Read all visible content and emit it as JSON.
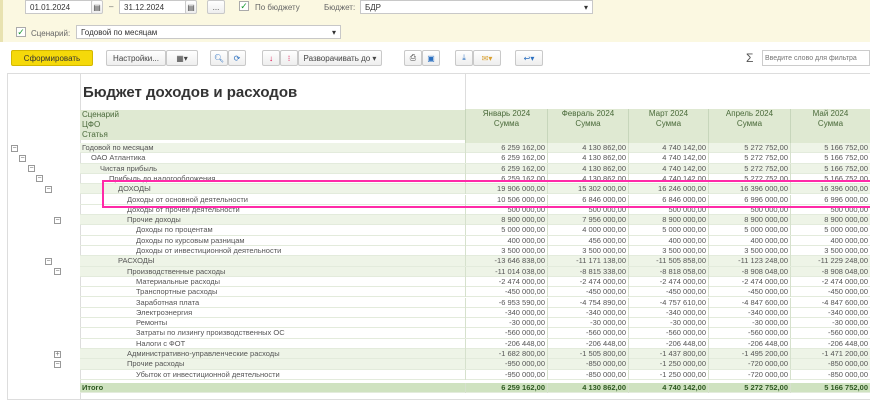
{
  "filters": {
    "date_from": "01.01.2024",
    "date_sep": "–",
    "date_to": "31.12.2024",
    "period_button": "...",
    "by_budget_label": "По бюджету",
    "by_budget_checked": true,
    "budget_label": "Бюджет:",
    "budget_value": "БДР",
    "scenario_label": "Сценарий:",
    "scenario_checked": true,
    "scenario_value": "Годовой по месяцам"
  },
  "toolbar": {
    "generate": "Сформировать",
    "settings": "Настройки...",
    "expand_to": "Разворачивать до",
    "sigma": "Σ",
    "search_placeholder": "Введите слово для фильтра"
  },
  "report": {
    "title": "Бюджет доходов и расходов",
    "header_rows": [
      "Сценарий",
      "ЦФО",
      "Статья"
    ],
    "months": [
      "Январь 2024",
      "Февраль 2024",
      "Март 2024",
      "Апрель 2024",
      "Май 2024"
    ],
    "sum_label": "Сумма",
    "rows": [
      {
        "label": "Годовой по месяцам",
        "level": 0,
        "toggle": "-",
        "group": true,
        "values": [
          "6 259 162,00",
          "4 130 862,00",
          "4 740 142,00",
          "5 272 752,00",
          "5 166 752,00"
        ]
      },
      {
        "label": "ОАО Атлантика",
        "level": 1,
        "toggle": "-",
        "group": false,
        "values": [
          "6 259 162,00",
          "4 130 862,00",
          "4 740 142,00",
          "5 272 752,00",
          "5 166 752,00"
        ]
      },
      {
        "label": "Чистая прибыль",
        "level": 2,
        "toggle": "-",
        "group": true,
        "values": [
          "6 259 162,00",
          "4 130 862,00",
          "4 740 142,00",
          "5 272 752,00",
          "5 166 752,00"
        ]
      },
      {
        "label": "Прибыль до налогообложения",
        "level": 3,
        "toggle": "-",
        "group": false,
        "values": [
          "6 259 162,00",
          "4 130 862,00",
          "4 740 142,00",
          "5 272 752,00",
          "5 166 752,00"
        ]
      },
      {
        "label": "ДОХОДЫ",
        "level": 4,
        "toggle": "-",
        "group": true,
        "values": [
          "19 906 000,00",
          "15 302 000,00",
          "16 246 000,00",
          "16 396 000,00",
          "16 396 000,00"
        ]
      },
      {
        "label": "Доходы от основной деятельности",
        "level": 5,
        "toggle": "",
        "group": false,
        "values": [
          "10 506 000,00",
          "6 846 000,00",
          "6 846 000,00",
          "6 996 000,00",
          "6 996 000,00"
        ]
      },
      {
        "label": "Доходы от прочей деятельности",
        "level": 5,
        "toggle": "",
        "group": false,
        "values": [
          "500 000,00",
          "500 000,00",
          "500 000,00",
          "500 000,00",
          "500 000,00"
        ]
      },
      {
        "label": "Прочие доходы",
        "level": 5,
        "toggle": "-",
        "group": true,
        "values": [
          "8 900 000,00",
          "7 956 000,00",
          "8 900 000,00",
          "8 900 000,00",
          "8 900 000,00"
        ]
      },
      {
        "label": "Доходы по процентам",
        "level": 6,
        "toggle": "",
        "group": false,
        "values": [
          "5 000 000,00",
          "4 000 000,00",
          "5 000 000,00",
          "5 000 000,00",
          "5 000 000,00"
        ]
      },
      {
        "label": "Доходы по курсовым разницам",
        "level": 6,
        "toggle": "",
        "group": false,
        "values": [
          "400 000,00",
          "456 000,00",
          "400 000,00",
          "400 000,00",
          "400 000,00"
        ]
      },
      {
        "label": "Доходы от инвестиционной деятельности",
        "level": 6,
        "toggle": "",
        "group": false,
        "values": [
          "3 500 000,00",
          "3 500 000,00",
          "3 500 000,00",
          "3 500 000,00",
          "3 500 000,00"
        ]
      },
      {
        "label": "РАСХОДЫ",
        "level": 4,
        "toggle": "-",
        "group": true,
        "values": [
          "-13 646 838,00",
          "-11 171 138,00",
          "-11 505 858,00",
          "-11 123 248,00",
          "-11 229 248,00"
        ]
      },
      {
        "label": "Производственные расходы",
        "level": 5,
        "toggle": "-",
        "group": true,
        "values": [
          "-11 014 038,00",
          "-8 815 338,00",
          "-8 818 058,00",
          "-8 908 048,00",
          "-8 908 048,00"
        ]
      },
      {
        "label": "Материальные расходы",
        "level": 6,
        "toggle": "",
        "group": false,
        "values": [
          "-2 474 000,00",
          "-2 474 000,00",
          "-2 474 000,00",
          "-2 474 000,00",
          "-2 474 000,00"
        ]
      },
      {
        "label": "Транспортные расходы",
        "level": 6,
        "toggle": "",
        "group": false,
        "values": [
          "-450 000,00",
          "-450 000,00",
          "-450 000,00",
          "-450 000,00",
          "-450 000,00"
        ]
      },
      {
        "label": "Заработная плата",
        "level": 6,
        "toggle": "",
        "group": false,
        "values": [
          "-6 953 590,00",
          "-4 754 890,00",
          "-4 757 610,00",
          "-4 847 600,00",
          "-4 847 600,00"
        ]
      },
      {
        "label": "Электроэнергия",
        "level": 6,
        "toggle": "",
        "group": false,
        "values": [
          "-340 000,00",
          "-340 000,00",
          "-340 000,00",
          "-340 000,00",
          "-340 000,00"
        ]
      },
      {
        "label": "Ремонты",
        "level": 6,
        "toggle": "",
        "group": false,
        "values": [
          "-30 000,00",
          "-30 000,00",
          "-30 000,00",
          "-30 000,00",
          "-30 000,00"
        ]
      },
      {
        "label": "Затраты по лизингу производственных ОС",
        "level": 6,
        "toggle": "",
        "group": false,
        "values": [
          "-560 000,00",
          "-560 000,00",
          "-560 000,00",
          "-560 000,00",
          "-560 000,00"
        ]
      },
      {
        "label": "Налоги с ФОТ",
        "level": 6,
        "toggle": "",
        "group": false,
        "values": [
          "-206 448,00",
          "-206 448,00",
          "-206 448,00",
          "-206 448,00",
          "-206 448,00"
        ]
      },
      {
        "label": "Административно-управленческие расходы",
        "level": 5,
        "toggle": "+",
        "group": true,
        "values": [
          "-1 682 800,00",
          "-1 505 800,00",
          "-1 437 800,00",
          "-1 495 200,00",
          "-1 471 200,00"
        ]
      },
      {
        "label": "Прочие расходы",
        "level": 5,
        "toggle": "-",
        "group": true,
        "values": [
          "-950 000,00",
          "-850 000,00",
          "-1 250 000,00",
          "-720 000,00",
          "-850 000,00"
        ]
      },
      {
        "label": "Убыток от инвестиционной деятельности",
        "level": 6,
        "toggle": "",
        "group": false,
        "values": [
          "-950 000,00",
          "-850 000,00",
          "-1 250 000,00",
          "-720 000,00",
          "-850 000,00"
        ]
      }
    ],
    "total": {
      "label": "Итого",
      "values": [
        "6 259 162,00",
        "4 130 862,00",
        "4 740 142,00",
        "5 272 752,00",
        "5 166 752,00"
      ]
    }
  },
  "colors": {
    "generate_button": "#f5d90a",
    "highlight": "#ff2aa8",
    "header_bg": "#dfe9d2"
  }
}
